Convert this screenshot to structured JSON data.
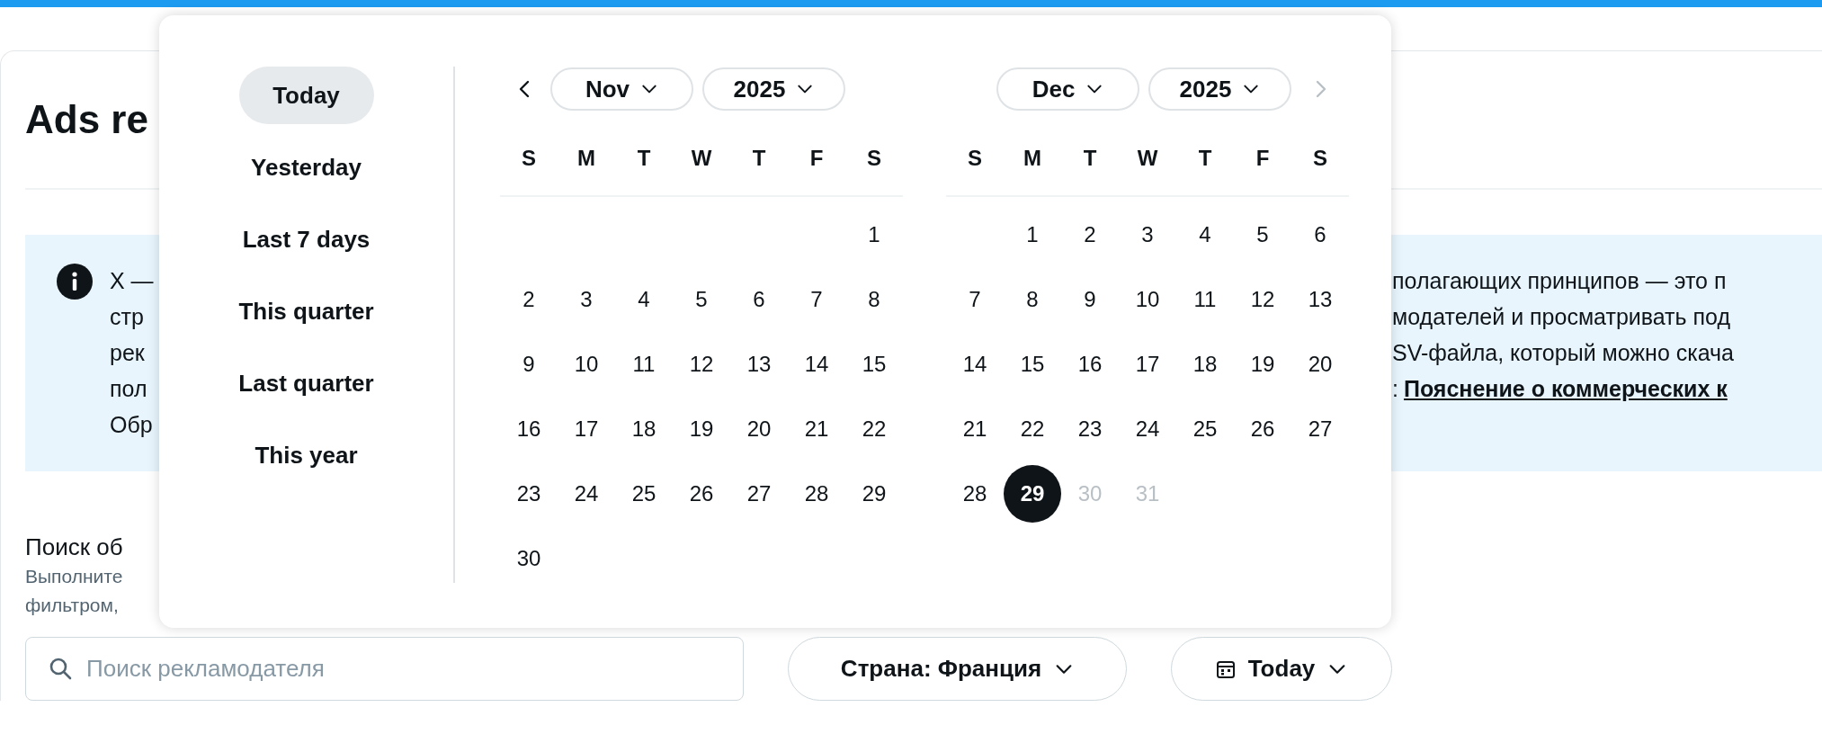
{
  "page": {
    "title": "Ads re"
  },
  "banner": {
    "left_lines": [
      "X —",
      "стр",
      "рек",
      "пол",
      "Обр"
    ],
    "right_lines": [
      [
        {
          "kind": "text",
          "text": "полагающих принципов — это п"
        }
      ],
      [
        {
          "kind": "text",
          "text": "модателей и просматривать под"
        }
      ],
      [
        {
          "kind": "text",
          "text": "SV-файла, который можно скача"
        }
      ],
      [
        {
          "kind": "text",
          "text": ":"
        },
        {
          "kind": "link",
          "text": "Пояснение о коммерческих к"
        }
      ]
    ]
  },
  "search_section": {
    "title": "Поиск об",
    "description_lines": [
      "Выполните",
      "фильтром,"
    ]
  },
  "search": {
    "placeholder": "Поиск рекламодателя"
  },
  "country_filter": {
    "label": "Страна: Франция"
  },
  "date_filter": {
    "label": "Today"
  },
  "date_popup": {
    "presets": [
      {
        "label": "Today",
        "selected": true
      },
      {
        "label": "Yesterday",
        "selected": false
      },
      {
        "label": "Last 7 days",
        "selected": false
      },
      {
        "label": "This quarter",
        "selected": false
      },
      {
        "label": "Last quarter",
        "selected": false
      },
      {
        "label": "This year",
        "selected": false
      }
    ],
    "calendars": [
      {
        "prev_button": {
          "disabled": false
        },
        "month": "Nov",
        "year": "2025",
        "first_week_right_aligned": true,
        "weekdays": [
          "S",
          "M",
          "T",
          "W",
          "T",
          "F",
          "S"
        ],
        "weeks": [
          [
            {
              "day": "1",
              "selected": false,
              "disabled": false
            }
          ],
          [
            {
              "day": "2",
              "selected": false,
              "disabled": false
            },
            {
              "day": "3",
              "selected": false,
              "disabled": false
            },
            {
              "day": "4",
              "selected": false,
              "disabled": false
            },
            {
              "day": "5",
              "selected": false,
              "disabled": false
            },
            {
              "day": "6",
              "selected": false,
              "disabled": false
            },
            {
              "day": "7",
              "selected": false,
              "disabled": false
            },
            {
              "day": "8",
              "selected": false,
              "disabled": false
            }
          ],
          [
            {
              "day": "9",
              "selected": false,
              "disabled": false
            },
            {
              "day": "10",
              "selected": false,
              "disabled": false
            },
            {
              "day": "11",
              "selected": false,
              "disabled": false
            },
            {
              "day": "12",
              "selected": false,
              "disabled": false
            },
            {
              "day": "13",
              "selected": false,
              "disabled": false
            },
            {
              "day": "14",
              "selected": false,
              "disabled": false
            },
            {
              "day": "15",
              "selected": false,
              "disabled": false
            }
          ],
          [
            {
              "day": "16",
              "selected": false,
              "disabled": false
            },
            {
              "day": "17",
              "selected": false,
              "disabled": false
            },
            {
              "day": "18",
              "selected": false,
              "disabled": false
            },
            {
              "day": "19",
              "selected": false,
              "disabled": false
            },
            {
              "day": "20",
              "selected": false,
              "disabled": false
            },
            {
              "day": "21",
              "selected": false,
              "disabled": false
            },
            {
              "day": "22",
              "selected": false,
              "disabled": false
            }
          ],
          [
            {
              "day": "23",
              "selected": false,
              "disabled": false
            },
            {
              "day": "24",
              "selected": false,
              "disabled": false
            },
            {
              "day": "25",
              "selected": false,
              "disabled": false
            },
            {
              "day": "26",
              "selected": false,
              "disabled": false
            },
            {
              "day": "27",
              "selected": false,
              "disabled": false
            },
            {
              "day": "28",
              "selected": false,
              "disabled": false
            },
            {
              "day": "29",
              "selected": false,
              "disabled": false
            }
          ],
          [
            {
              "day": "30",
              "selected": false,
              "disabled": false
            }
          ]
        ]
      },
      {
        "next_button": {
          "disabled": true
        },
        "month": "Dec",
        "year": "2025",
        "first_week_right_aligned": true,
        "weekdays": [
          "S",
          "M",
          "T",
          "W",
          "T",
          "F",
          "S"
        ],
        "weeks": [
          [
            {
              "day": "1",
              "selected": false,
              "disabled": false
            },
            {
              "day": "2",
              "selected": false,
              "disabled": false
            },
            {
              "day": "3",
              "selected": false,
              "disabled": false
            },
            {
              "day": "4",
              "selected": false,
              "disabled": false
            },
            {
              "day": "5",
              "selected": false,
              "disabled": false
            },
            {
              "day": "6",
              "selected": false,
              "disabled": false
            }
          ],
          [
            {
              "day": "7",
              "selected": false,
              "disabled": false
            },
            {
              "day": "8",
              "selected": false,
              "disabled": false
            },
            {
              "day": "9",
              "selected": false,
              "disabled": false
            },
            {
              "day": "10",
              "selected": false,
              "disabled": false
            },
            {
              "day": "11",
              "selected": false,
              "disabled": false
            },
            {
              "day": "12",
              "selected": false,
              "disabled": false
            },
            {
              "day": "13",
              "selected": false,
              "disabled": false
            }
          ],
          [
            {
              "day": "14",
              "selected": false,
              "disabled": false
            },
            {
              "day": "15",
              "selected": false,
              "disabled": false
            },
            {
              "day": "16",
              "selected": false,
              "disabled": false
            },
            {
              "day": "17",
              "selected": false,
              "disabled": false
            },
            {
              "day": "18",
              "selected": false,
              "disabled": false
            },
            {
              "day": "19",
              "selected": false,
              "disabled": false
            },
            {
              "day": "20",
              "selected": false,
              "disabled": false
            }
          ],
          [
            {
              "day": "21",
              "selected": false,
              "disabled": false
            },
            {
              "day": "22",
              "selected": false,
              "disabled": false
            },
            {
              "day": "23",
              "selected": false,
              "disabled": false
            },
            {
              "day": "24",
              "selected": false,
              "disabled": false
            },
            {
              "day": "25",
              "selected": false,
              "disabled": false
            },
            {
              "day": "26",
              "selected": false,
              "disabled": false
            },
            {
              "day": "27",
              "selected": false,
              "disabled": false
            }
          ],
          [
            {
              "day": "28",
              "selected": false,
              "disabled": false
            },
            {
              "day": "29",
              "selected": true,
              "disabled": false
            },
            {
              "day": "30",
              "selected": false,
              "disabled": true
            },
            {
              "day": "31",
              "selected": false,
              "disabled": true
            }
          ]
        ]
      }
    ]
  }
}
